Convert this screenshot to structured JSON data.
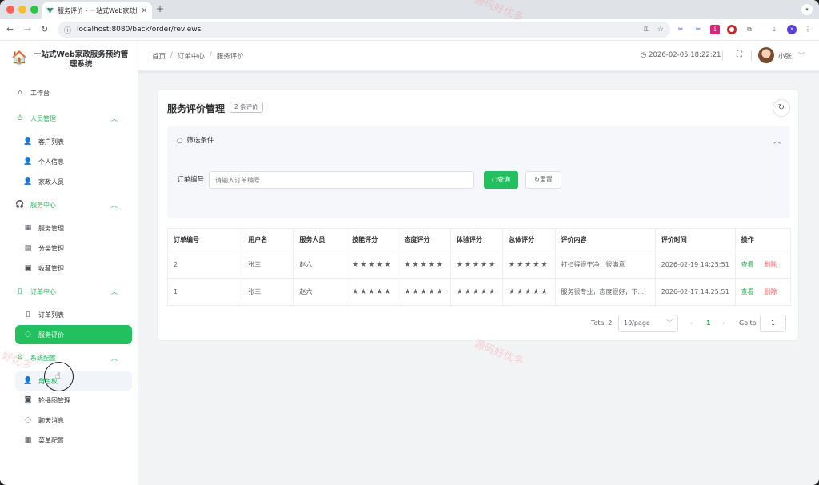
{
  "browser": {
    "tab_title": "服务评价 - 一站式Web家政服务",
    "url": "localhost:8080/back/order/reviews"
  },
  "app": {
    "brand_line1": "一站式Web家政服务预约管",
    "brand_line2": "理系统"
  },
  "sidebar": {
    "workbench": "工作台",
    "groups": [
      {
        "label": "人员管理",
        "items": [
          "客户列表",
          "个人信息",
          "家政人员"
        ]
      },
      {
        "label": "服务中心",
        "items": [
          "服务管理",
          "分类管理",
          "收藏管理"
        ]
      },
      {
        "label": "订单中心",
        "items": [
          "订单列表",
          "服务评价"
        ]
      },
      {
        "label": "系统配置",
        "items": [
          "角色权",
          "轮播图管理",
          "聊天消息",
          "菜单配置"
        ]
      }
    ]
  },
  "header": {
    "breadcrumb": [
      "首页",
      "订单中心",
      "服务评价"
    ],
    "datetime": "2026-02-05 18:22:21",
    "username": "小张"
  },
  "page": {
    "title": "服务评价管理",
    "count_badge": "2 条评价",
    "filter_title": "筛选条件",
    "order_no_label": "订单编号",
    "order_no_placeholder": "请输入订单编号",
    "search_label": "查询",
    "reset_label": "重置"
  },
  "table": {
    "columns": [
      "订单编号",
      "用户名",
      "服务人员",
      "技能评分",
      "态度评分",
      "体验评分",
      "总体评分",
      "评价内容",
      "评价时间",
      "操作"
    ],
    "rows": [
      {
        "order_no": "2",
        "user": "张三",
        "staff": "赵六",
        "skill": 5,
        "attitude": 5,
        "experience": 5,
        "overall": 5,
        "content": "打扫得很干净，很满意",
        "time": "2026-02-19 14:25:51"
      },
      {
        "order_no": "1",
        "user": "张三",
        "staff": "赵六",
        "skill": 5,
        "attitude": 5,
        "experience": 5,
        "overall": 5,
        "content": "服务很专业，态度很好，下...",
        "time": "2026-02-17 14:25:51"
      }
    ],
    "view_label": "查看",
    "delete_label": "删除"
  },
  "pagination": {
    "total": "Total 2",
    "page_size": "10/page",
    "current_page": "1",
    "goto_label": "Go to",
    "goto_value": "1"
  },
  "watermarks": [
    "好优多",
    "源码好优多",
    "源码好优多"
  ],
  "colors": {
    "accent": "#22c05f",
    "danger": "#f56c6c",
    "star": "#f0b429"
  }
}
